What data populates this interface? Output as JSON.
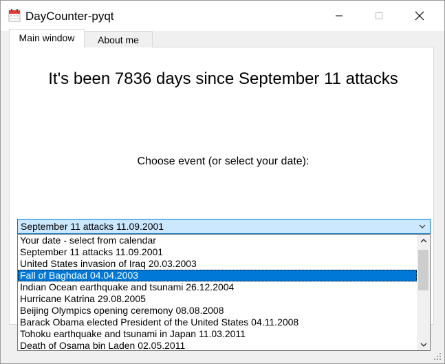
{
  "window": {
    "title": "DayCounter-pyqt"
  },
  "tabs": [
    {
      "label": "Main window",
      "active": true
    },
    {
      "label": "About me",
      "active": false
    }
  ],
  "main": {
    "headline": "It's been 7836 days since September 11 attacks",
    "prompt": "Choose event (or select your date):"
  },
  "combo": {
    "selected": "September 11 attacks 11.09.2001",
    "options": [
      "Your date - select from calendar",
      "September 11 attacks 11.09.2001",
      "United States invasion of Iraq 20.03.2003",
      "Fall of Baghdad 04.04.2003",
      "Indian Ocean earthquake and tsunami 26.12.2004",
      "Hurricane Katrina 29.08.2005",
      "Beijing Olympics opening ceremony 08.08.2008",
      "Barack Obama elected President of the United States 04.11.2008",
      "Tohoku earthquake and tsunami in Japan 11.03.2011",
      "Death of Osama bin Laden 02.05.2011"
    ],
    "highlighted_index": 3
  },
  "icons": {
    "app": "calendar-icon",
    "minimize": "minimize-icon",
    "maximize": "maximize-icon",
    "close": "close-icon",
    "dropdown": "chevron-down-icon",
    "scroll_up": "chevron-up-icon",
    "scroll_down": "chevron-down-icon"
  },
  "colors": {
    "accent": "#0078d7",
    "combo_bg": "#cce8ff"
  }
}
